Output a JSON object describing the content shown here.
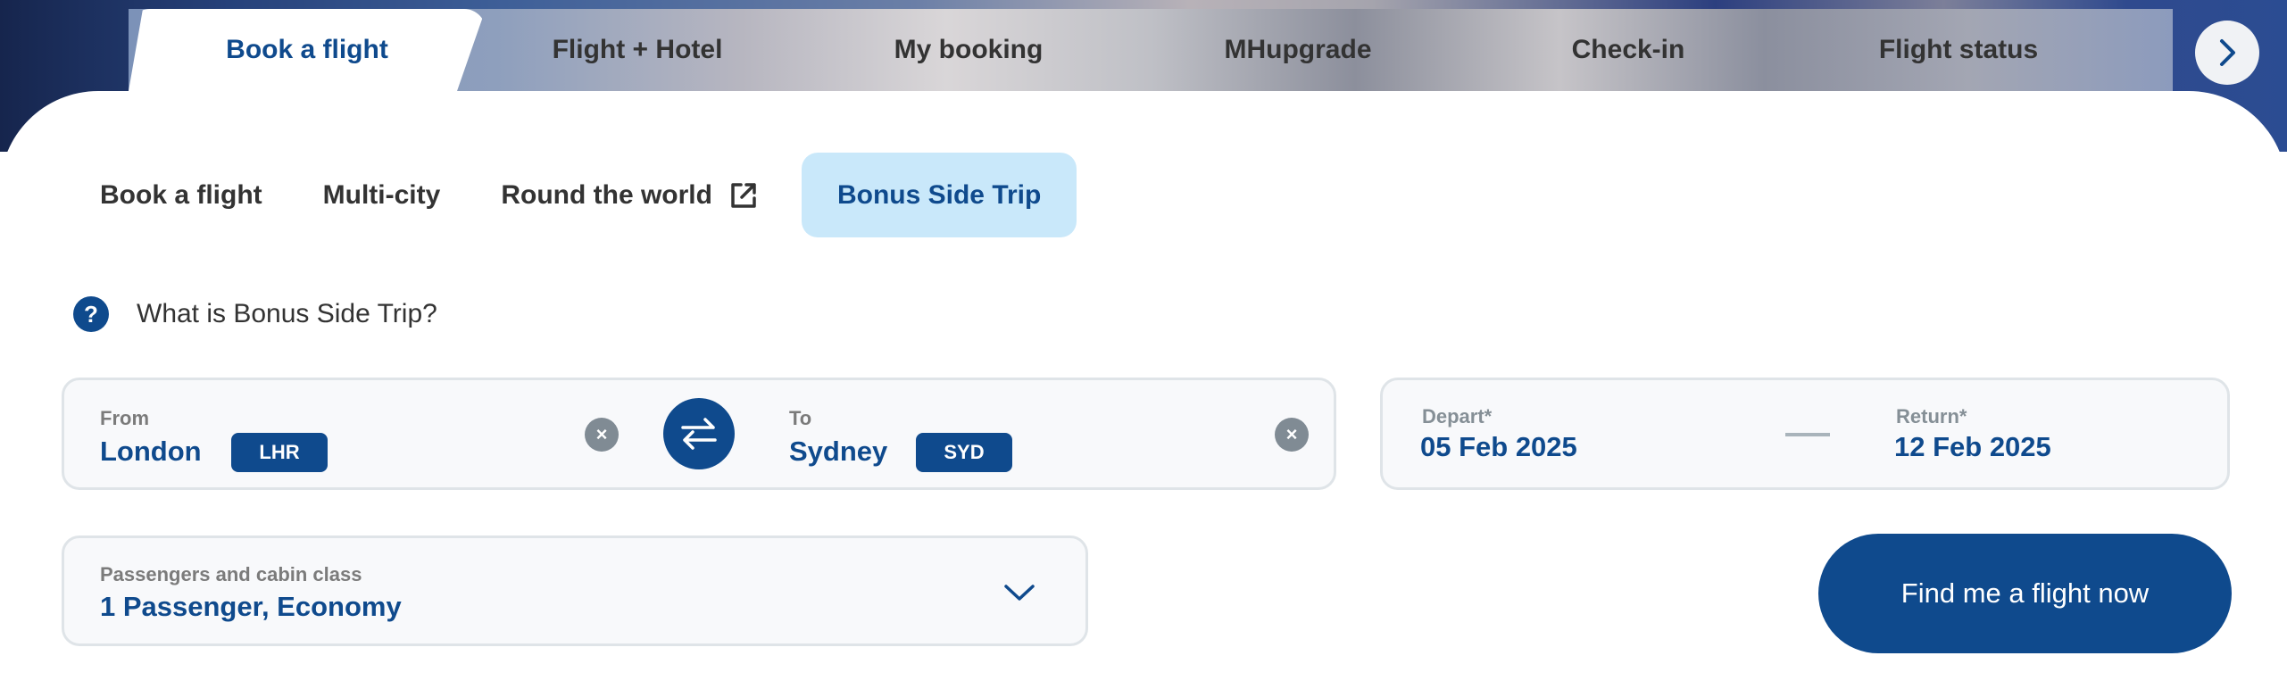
{
  "top_nav": {
    "tabs": [
      {
        "label": "Book a flight",
        "active": true
      },
      {
        "label": "Flight + Hotel",
        "active": false
      },
      {
        "label": "My booking",
        "active": false
      },
      {
        "label": "MHupgrade",
        "active": false
      },
      {
        "label": "Check-in",
        "active": false
      },
      {
        "label": "Flight status",
        "active": false
      }
    ],
    "next_icon": "chevron-right-icon"
  },
  "sub_tabs": [
    {
      "label": "Book a flight",
      "active": false
    },
    {
      "label": "Multi-city",
      "active": false
    },
    {
      "label": "Round the world",
      "active": false,
      "icon": "external-link-icon"
    },
    {
      "label": "Bonus Side Trip",
      "active": true
    }
  ],
  "help": {
    "icon": "question-icon",
    "icon_glyph": "?",
    "text": "What is Bonus Side Trip?"
  },
  "route": {
    "from": {
      "label": "From",
      "city": "London",
      "code": "LHR"
    },
    "to": {
      "label": "To",
      "city": "Sydney",
      "code": "SYD"
    },
    "clear_glyph": "×",
    "swap_icon": "swap-arrows-icon"
  },
  "dates": {
    "depart": {
      "label": "Depart*",
      "value": "05 Feb 2025"
    },
    "return": {
      "label": "Return*",
      "value": "12 Feb 2025"
    }
  },
  "passengers": {
    "label": "Passengers and cabin class",
    "value": "1 Passenger, Economy",
    "icon": "chevron-down-icon"
  },
  "search_button": {
    "label": "Find me a flight now"
  },
  "colors": {
    "brand": "#0f4a8d",
    "active_subtab_bg": "#c9e8fa",
    "clear_icon_bg": "#808b94",
    "field_bg": "#f8f9fb",
    "field_border": "#dfe4e8"
  }
}
